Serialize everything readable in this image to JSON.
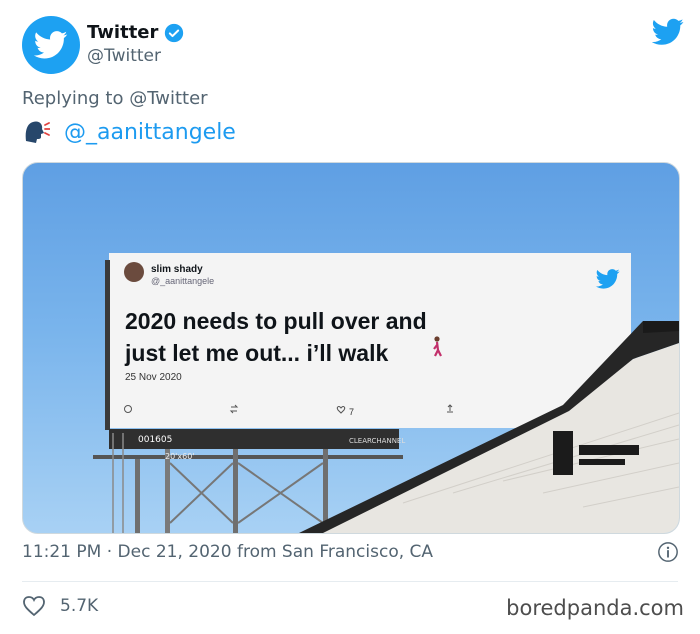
{
  "author": {
    "display_name": "Twitter",
    "handle": "@Twitter",
    "verified_icon": "verified-badge-icon"
  },
  "reply": {
    "prefix": "Replying to",
    "to_handle": "@Twitter"
  },
  "mention": {
    "emoji_icon": "speaking-head-icon",
    "handle": "@_aanittangele"
  },
  "media": {
    "billboard_tweet": {
      "name": "slim shady",
      "handle": "@_aanittangele",
      "line1": "2020 needs to pull over and",
      "line2": "just let me out... i’ll walk",
      "date": "25 Nov 2020",
      "likes": "7"
    },
    "plate_number": "001605",
    "plate_size": "20'x60'",
    "plate_brand": "CLEARCHANNEL"
  },
  "meta": {
    "time": "11:21 PM",
    "separator": "·",
    "date": "Dec 21, 2020",
    "source": "from San Francisco, CA"
  },
  "stats": {
    "likes": "5.7K"
  },
  "watermark": "boredpanda.com",
  "colors": {
    "twitter_blue": "#1da1f2",
    "link": "#1d9bf0",
    "muted": "#536471"
  }
}
